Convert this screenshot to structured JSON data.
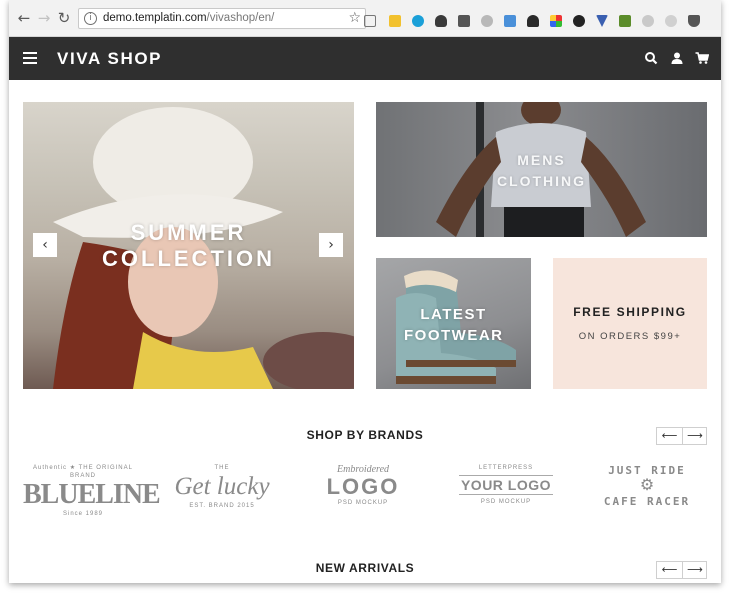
{
  "browser": {
    "url_host": "demo.templatin.com",
    "url_path": "/vivashop/en/",
    "back_icon": "arrow-left",
    "forward_icon": "arrow-right",
    "reload_icon": "reload",
    "info_icon": "i",
    "star_icon": "star"
  },
  "header": {
    "logo": "VIVA SHOP",
    "menu_icon": "hamburger",
    "search_icon": "search",
    "account_icon": "user",
    "cart_icon": "cart"
  },
  "hero": {
    "summer_caption": "SUMMER COLLECTION",
    "mens_caption": "MENS CLOTHING",
    "footwear_caption": "LATEST FOOTWEAR",
    "shipping_title": "FREE SHIPPING",
    "shipping_sub": "ON ORDERS $99+",
    "prev_arrow": "‹",
    "next_arrow": "›"
  },
  "brands": {
    "title": "SHOP BY BRANDS",
    "prev": "⟵",
    "next": "⟶",
    "items": [
      {
        "top": "Authentic ★ THE ORIGINAL BRAND",
        "main": "BLUELINE",
        "bottom": "Since 1989"
      },
      {
        "top": "THE",
        "main": "Get lucky",
        "bottom": "EST. BRAND 2015"
      },
      {
        "top": "Embroidered",
        "main": "LOGO",
        "bottom": "PSD MOCKUP"
      },
      {
        "top": "LETTERPRESS",
        "main": "YOUR LOGO",
        "bottom": "PSD MOCKUP"
      },
      {
        "top": "JUST RIDE",
        "main": "CAFE RACER",
        "bottom": ""
      }
    ]
  },
  "new_arrivals": {
    "title": "NEW ARRIVALS",
    "prev": "⟵",
    "next": "⟶"
  }
}
